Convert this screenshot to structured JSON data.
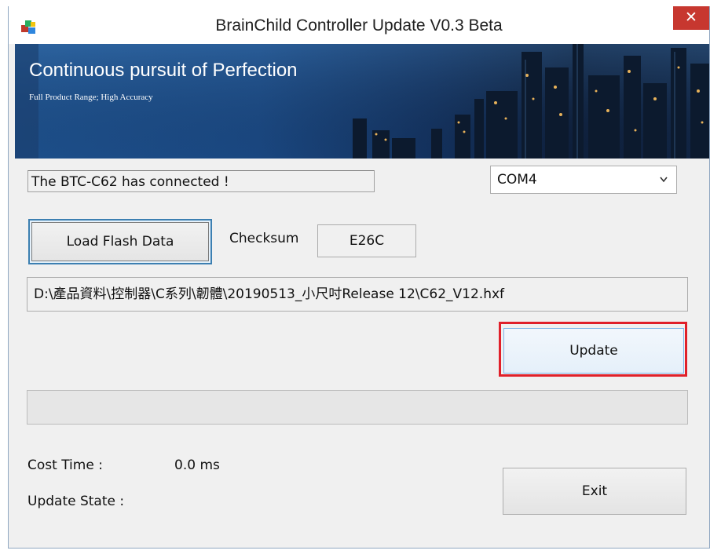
{
  "window": {
    "title": "BrainChild Controller Update V0.3 Beta",
    "close_glyph": "✕",
    "icon": "app-icon"
  },
  "banner": {
    "title": "Continuous pursuit of Perfection",
    "subtitle": "Full Product Range; High Accuracy"
  },
  "status": {
    "message": "The BTC-C62 has connected !"
  },
  "port_select": {
    "selected": "COM4",
    "chevron_icon": "chevron-down-icon"
  },
  "load": {
    "button_label": "Load Flash Data",
    "checksum_label": "Checksum",
    "checksum_value": "E26C"
  },
  "file": {
    "path": "D:\\產品資料\\控制器\\C系列\\韌體\\20190513_小尺吋Release 12\\C62_V12.hxf"
  },
  "actions": {
    "update_label": "Update",
    "exit_label": "Exit"
  },
  "progress": {
    "value_percent": 0
  },
  "stats": {
    "cost_time_label": "Cost Time :",
    "cost_time_value": "0.0 ms",
    "update_state_label": "Update State :",
    "update_state_value": ""
  },
  "colors": {
    "highlight": "#e0202a",
    "close_button": "#c7372f",
    "banner": "#1a4780"
  }
}
